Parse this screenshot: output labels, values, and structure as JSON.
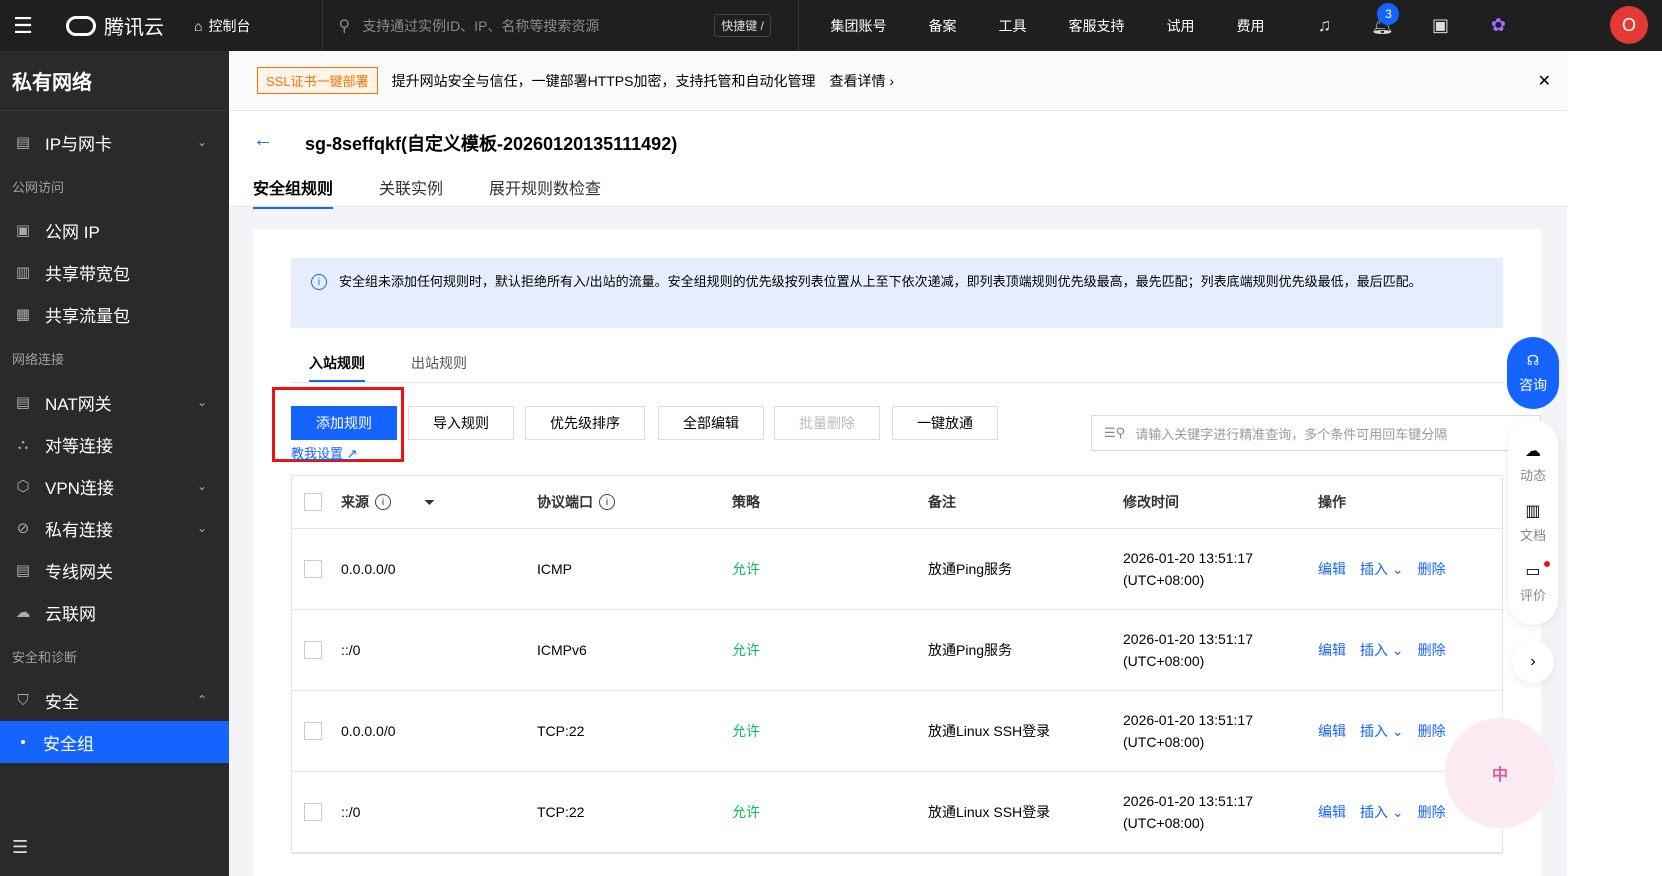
{
  "topbar": {
    "logo": "腾讯云",
    "console": "控制台",
    "search_placeholder": "支持通过实例ID、IP、名称等搜索资源",
    "shortcut": "快捷键 /",
    "nav": [
      "集团账号",
      "备案",
      "工具",
      "客服支持",
      "试用",
      "费用"
    ],
    "notification_count": "3",
    "avatar": "O"
  },
  "sidebar": {
    "title": "私有网络",
    "items": [
      {
        "label": "IP与网卡",
        "chevron": "⌄"
      },
      {
        "group": "公网访问"
      },
      {
        "label": "公网 IP"
      },
      {
        "label": "共享带宽包"
      },
      {
        "label": "共享流量包"
      },
      {
        "group": "网络连接"
      },
      {
        "label": "NAT网关",
        "chevron": "⌄"
      },
      {
        "label": "对等连接"
      },
      {
        "label": "VPN连接",
        "chevron": "⌄"
      },
      {
        "label": "私有连接",
        "chevron": "⌄"
      },
      {
        "label": "专线网关"
      },
      {
        "label": "云联网"
      },
      {
        "group": "安全和诊断"
      },
      {
        "label": "安全",
        "chevron": "⌃"
      },
      {
        "label": "安全组",
        "active": true
      }
    ]
  },
  "banner": {
    "tag": "SSL证书一键部署",
    "text": "提升网站安全与信任，一键部署HTTPS加密，支持托管和自动化管理",
    "link": "查看详情 ›"
  },
  "header": {
    "title": "sg-8seffqkf(自定义模板-20260120135111492)",
    "tabs": [
      "安全组规则",
      "关联实例",
      "展开规则数检查"
    ]
  },
  "info": "安全组未添加任何规则时，默认拒绝所有入/出站的流量。安全组规则的优先级按列表位置从上至下依次递减，即列表顶端规则优先级最高，最先匹配；列表底端规则优先级最低，最后匹配。",
  "subtabs": [
    "入站规则",
    "出站规则"
  ],
  "toolbar": {
    "add": "添加规则",
    "help": "教我设置",
    "import": "导入规则",
    "priority": "优先级排序",
    "edit_all": "全部编辑",
    "batch_delete": "批量删除",
    "open_all": "一键放通",
    "search_placeholder": "请输入关键字进行精准查询，多个条件可用回车键分隔"
  },
  "table": {
    "headers": {
      "source": "来源",
      "port": "协议端口",
      "policy": "策略",
      "remark": "备注",
      "time": "修改时间",
      "ops": "操作"
    },
    "rows": [
      {
        "source": "0.0.0.0/0",
        "port": "ICMP",
        "policy": "允许",
        "remark": "放通Ping服务",
        "time1": "2026-01-20 13:51:17",
        "time2": "(UTC+08:00)"
      },
      {
        "source": "::/0",
        "port": "ICMPv6",
        "policy": "允许",
        "remark": "放通Ping服务",
        "time1": "2026-01-20 13:51:17",
        "time2": "(UTC+08:00)"
      },
      {
        "source": "0.0.0.0/0",
        "port": "TCP:22",
        "policy": "允许",
        "remark": "放通Linux SSH登录",
        "time1": "2026-01-20 13:51:17",
        "time2": "(UTC+08:00)"
      },
      {
        "source": "::/0",
        "port": "TCP:22",
        "policy": "允许",
        "remark": "放通Linux SSH登录",
        "time1": "2026-01-20 13:51:17",
        "time2": "(UTC+08:00)"
      }
    ],
    "ops": {
      "edit": "编辑",
      "insert": "插入 ⌄",
      "delete": "删除"
    }
  },
  "float": {
    "consult": "咨询",
    "dynamic": "动态",
    "docs": "文档",
    "review": "评价"
  },
  "mascot": "中"
}
